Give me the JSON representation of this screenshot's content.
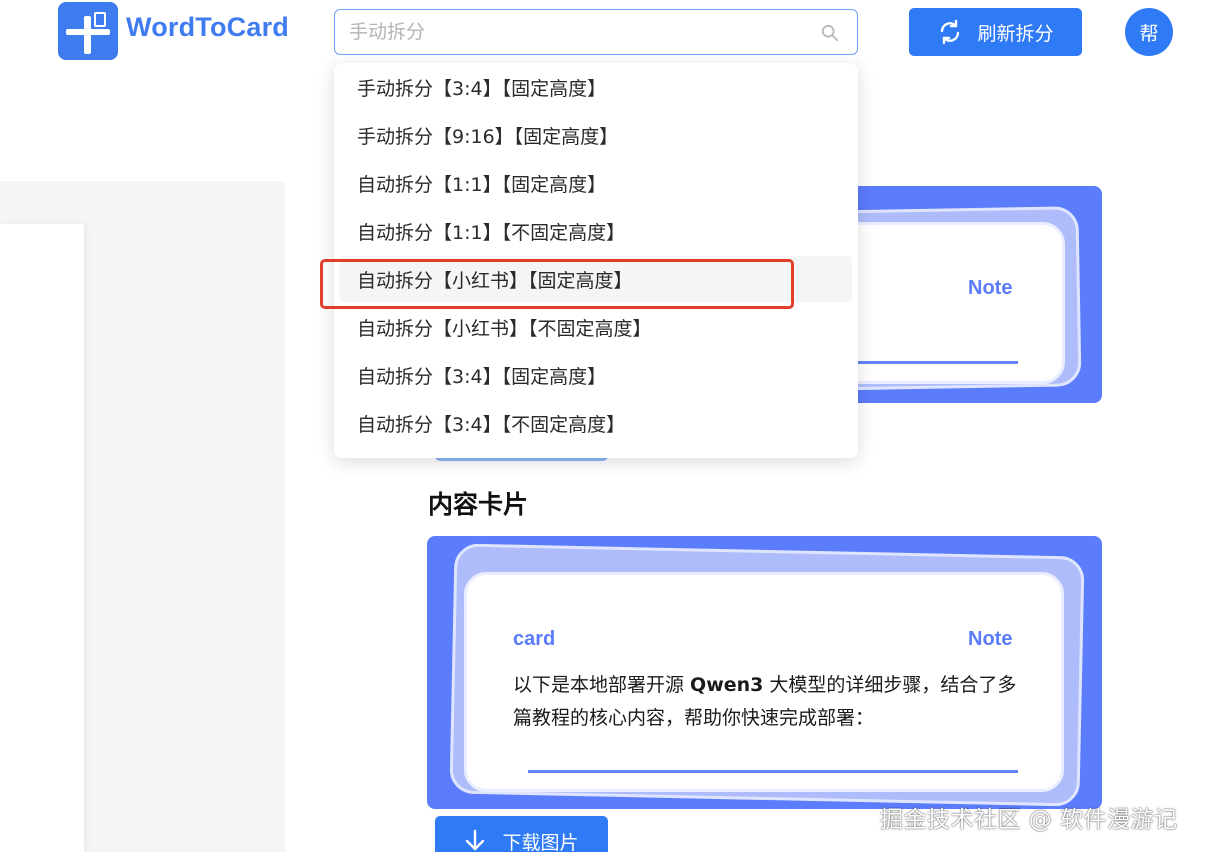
{
  "header": {
    "app_name": "WordToCard",
    "search": {
      "placeholder": "手动拆分",
      "value": ""
    },
    "refresh_label": "刷新拆分",
    "avatar_text": "帮"
  },
  "dropdown": {
    "items": [
      "手动拆分【3:4】【固定高度】",
      "手动拆分【9:16】【固定高度】",
      "自动拆分【1:1】【固定高度】",
      "自动拆分【1:1】【不固定高度】",
      "自动拆分【小红书】【固定高度】",
      "自动拆分【小红书】【不固定高度】",
      "自动拆分【3:4】【固定高度】",
      "自动拆分【3:4】【不固定高度】"
    ],
    "highlighted_index": 4
  },
  "cover_card": {
    "note_label": "Note"
  },
  "content_section": {
    "title": "内容卡片",
    "card": {
      "left_tag": "card",
      "right_tag": "Note",
      "text_before": "以下是本地部署开源 ",
      "text_bold": "Qwen3",
      "text_after": " 大模型的详细步骤，结合了多篇教程的核心内容，帮助你快速完成部署："
    },
    "download_label": "下载图片"
  },
  "watermark": "掘金技术社区 @ 软件漫游记",
  "colors": {
    "accent": "#2f7af5",
    "card_frame": "#5b7cfb",
    "highlight_border": "#e0402a"
  }
}
